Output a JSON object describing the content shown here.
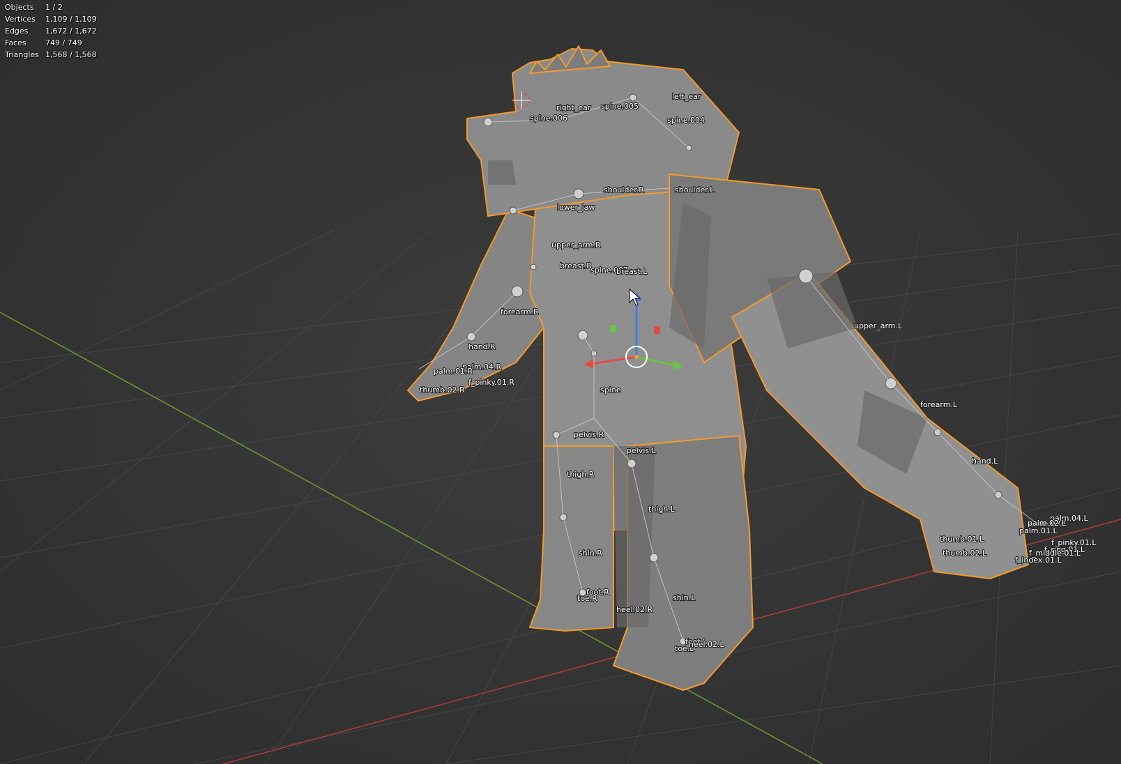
{
  "stats": [
    {
      "label": "Objects",
      "value": "1 / 2"
    },
    {
      "label": "Vertices",
      "value": "1,109 / 1,109"
    },
    {
      "label": "Edges",
      "value": "1,672 / 1,672"
    },
    {
      "label": "Faces",
      "value": "749 / 749"
    },
    {
      "label": "Triangles",
      "value": "1,568 / 1,568"
    }
  ],
  "bones": {
    "right_ear": "right_ear",
    "left_ear": "left_ear",
    "spine005": "spine.005",
    "spine006": "spine.006",
    "spine004": "spine.004",
    "shoulder_r": "shoulder.R",
    "shoulder_l": "shoulder.L",
    "lower_jaw": "lower_jaw",
    "upper_arm_r": "upper_arm.R",
    "breast_r": "breast.R",
    "spine007": "spine.007",
    "breast_l": "breast.L",
    "forearm_r": "forearm.R",
    "hand_r": "hand.R",
    "palm04_r": "palm.04.R",
    "palm_r_cluster": "palm.01.R",
    "f_pinky01_r": "f_pinky.01.R",
    "thumb02_r": "thumb.02.R",
    "upper_arm_l": "upper_arm.L",
    "spine": "spine",
    "forearm_l": "forearm.L",
    "pelvis_r": "pelvis.R",
    "pelvis_l": "pelvis.L",
    "hand_l": "hand.L",
    "thigh_r": "thigh.R",
    "thigh_l": "thigh.L",
    "palm04_l": "palm.04.L",
    "palm03_l": "palm.03.L",
    "palm02_l": "palm.02.L",
    "palm01_l": "palm.01.L",
    "thumb01_l": "thumb.01.L",
    "f_pinky01_l": "f_pinky.01.L",
    "f_ring01_l": "f_ring.01.L",
    "f_middle01_l": "f_middle.01.L",
    "thumb02_l": "thumb.02.L",
    "f_index01_l": "f_index.01.L",
    "shin_r": "shin.R",
    "foot_r": "foot.R",
    "toe_r": "toe.R",
    "shin_l": "shin.L",
    "heel02_r": "heel.02.R",
    "foot_l": "foot.L",
    "toe_l": "toe.L",
    "heel02_l": "heel.02.L"
  },
  "colors": {
    "background": "#3a3a3a",
    "grid": "#444444",
    "x_axis": "#b33a3a",
    "y_axis": "#6f9632",
    "selection_outline": "#f39a2b",
    "mesh": "#8a8a8a"
  }
}
